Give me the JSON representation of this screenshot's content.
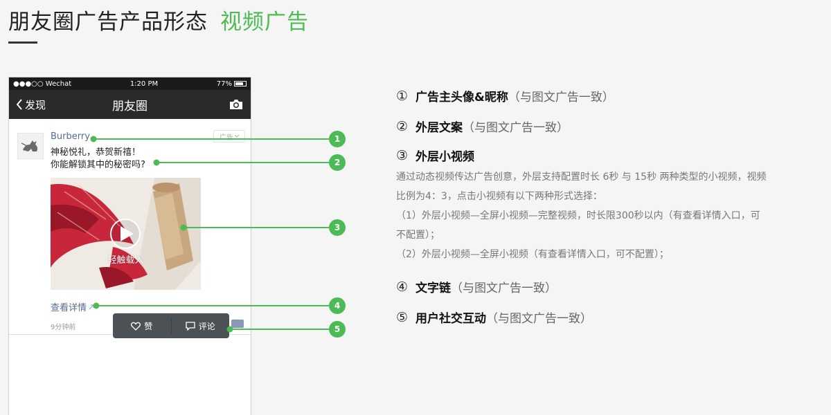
{
  "header": {
    "title": "朋友圈广告产品形态",
    "accent": "视频广告"
  },
  "phone": {
    "status": {
      "carrier": "●●●○○ Wechat",
      "time": "1:20 PM",
      "battery_text": "77%",
      "battery_level": 0.77
    },
    "nav": {
      "back_label": "发现",
      "title": "朋友圈"
    },
    "post": {
      "nickname": "Burberry",
      "ad_tag": "广告",
      "copy_line1": "神秘悦礼，恭贺新禧！",
      "copy_line2": "你能解锁其中的秘密吗?",
      "video_overlay": "轻触载入",
      "link_text": "查看详情",
      "timestamp": "9分钟前",
      "like_label": "赞",
      "comment_label": "评论"
    }
  },
  "badges": [
    "1",
    "2",
    "3",
    "4",
    "5"
  ],
  "description": {
    "items": [
      {
        "num": "①",
        "label": "广告主头像&昵称",
        "note": "（与图文广告一致）"
      },
      {
        "num": "②",
        "label": "外层文案",
        "note": "（与图文广告一致）"
      },
      {
        "num": "③",
        "label": "外层小视频",
        "note": ""
      },
      {
        "num": "④",
        "label": "文字链",
        "note": "（与图文广告一致）"
      },
      {
        "num": "⑤",
        "label": "用户社交互动",
        "note": "（与图文广告一致）"
      }
    ],
    "video_lines": [
      "通过动态视频传达广告创意，外层支持配置时长 6秒 与 15秒 两种类型的小视频，视频",
      "比例为4：3，点击小视频有以下两种形式选择：",
      "（1）外层小视频—全屏小视频—完整视频，时长限300秒以内（有查看详情入口，可",
      "不配置）；",
      "（2）外层小视频—全屏小视频（有查看详情入口，可不配置）；"
    ]
  },
  "colors": {
    "accent": "#4cbb55",
    "link": "#576b95",
    "nav_bg": "#2a2a2a"
  }
}
